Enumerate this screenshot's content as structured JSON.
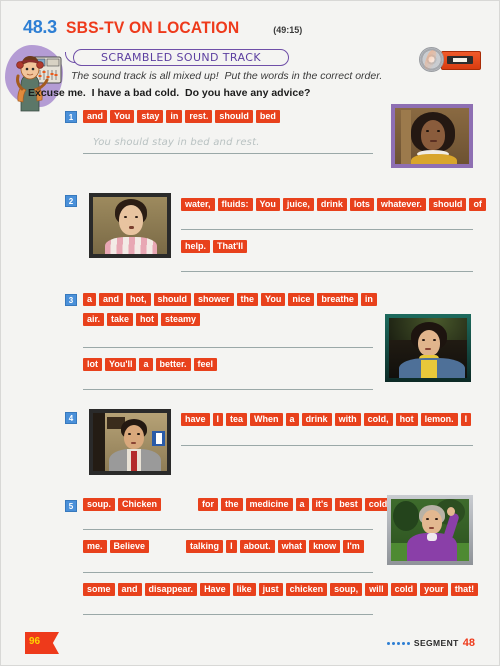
{
  "header": {
    "section_number": "48.3",
    "title": "SBS-TV ON LOCATION",
    "timecode": "(49:15)"
  },
  "banner": {
    "label": "SCRAMBLED SOUND TRACK"
  },
  "instructions": "The sound track is all mixed up!  Put the words in the correct order.",
  "dialogue_prompt": "Excuse me.  I have a bad cold.  Do you have any advice?",
  "media": {
    "cd_icon": "cd-icon",
    "cassette_icon": "cassette-icon"
  },
  "mascot": {
    "name": "sound-engineer-mascot"
  },
  "exercises": [
    {
      "number": "1",
      "photo_alt": "woman-with-curly-hair",
      "rows": [
        {
          "tiles": [
            "and",
            "You",
            "stay",
            "in",
            "rest.",
            "should",
            "bed"
          ]
        }
      ],
      "answer": "You should stay in bed and rest."
    },
    {
      "number": "2",
      "photo_alt": "man-in-striped-shirt",
      "rows": [
        {
          "tiles": [
            "water,",
            "fluids:",
            "You",
            "juice,",
            "drink",
            "lots",
            "whatever.",
            "should",
            "of"
          ]
        },
        {
          "tiles": [
            "help.",
            "That'll"
          ]
        }
      ],
      "answer": ""
    },
    {
      "number": "3",
      "photo_alt": "woman-in-denim-jacket",
      "rows": [
        {
          "tiles": [
            "a",
            "and",
            "hot,",
            "should",
            "shower",
            "the",
            "You",
            "nice",
            "breathe",
            "in"
          ]
        },
        {
          "tiles": [
            "air.",
            "take",
            "hot",
            "steamy"
          ]
        },
        {
          "tiles": [
            "lot",
            "You'll",
            "a",
            "better.",
            "feel"
          ]
        }
      ],
      "answer": ""
    },
    {
      "number": "4",
      "photo_alt": "man-in-suit-with-red-tie",
      "rows": [
        {
          "tiles": [
            "have",
            "I",
            "tea",
            "When",
            "a",
            "drink",
            "with",
            "cold,",
            "hot",
            "lemon.",
            "I"
          ]
        }
      ],
      "answer": ""
    },
    {
      "number": "5",
      "photo_alt": "older-woman-in-purple",
      "rows": [
        {
          "tiles": [
            "soup.",
            "Chicken",
            "for",
            "the",
            "medicine",
            "a",
            "it's",
            "best",
            "cold."
          ]
        },
        {
          "tiles": [
            "me.",
            "Believe",
            "talking",
            "I",
            "about.",
            "what",
            "know",
            "I'm"
          ]
        },
        {
          "tiles": [
            "some",
            "and",
            "disappear.",
            "Have",
            "like",
            "just",
            "chicken",
            "soup,",
            "will",
            "cold",
            "your",
            "that!"
          ]
        }
      ],
      "answer": ""
    }
  ],
  "footer": {
    "page_number": "96",
    "segment_label": "SEGMENT",
    "segment_number": "48"
  },
  "colors": {
    "tile": "#e8411c",
    "badge": "#4a90d9",
    "accent_red": "#ee3a1b",
    "accent_blue": "#2e7fd4",
    "banner_purple": "#5c3fa0"
  }
}
